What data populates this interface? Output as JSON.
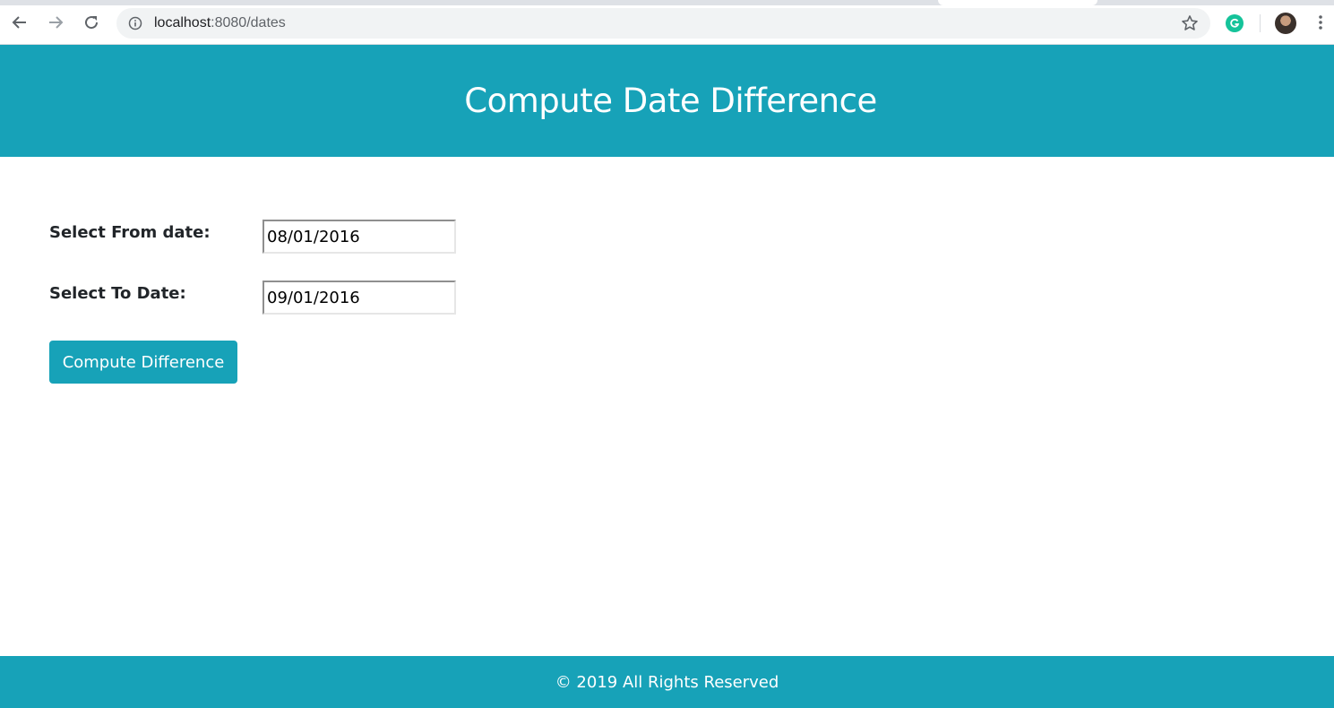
{
  "browser": {
    "url_host": "localhost",
    "url_path": ":8080/dates",
    "icons": {
      "back": "arrow-left-icon",
      "forward": "arrow-right-icon",
      "reload": "reload-icon",
      "info": "info-icon",
      "bookmark": "star-icon",
      "extension": "grammarly-icon",
      "profile": "avatar",
      "menu": "kebab-menu-icon"
    }
  },
  "header": {
    "title": "Compute Date Difference",
    "background_color": "#17a2b8"
  },
  "form": {
    "from_label": "Select From date:",
    "from_value": "08/01/2016",
    "to_label": "Select To Date:",
    "to_value": "09/01/2016",
    "submit_label": "Compute Difference"
  },
  "footer": {
    "text": "© 2019 All Rights Reserved",
    "background_color": "#17a2b8"
  }
}
